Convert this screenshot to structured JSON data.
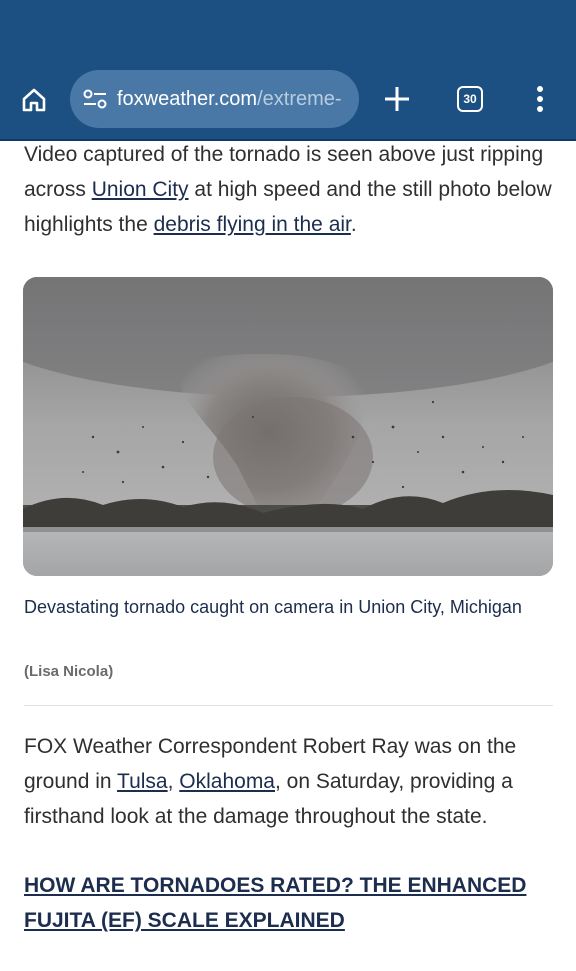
{
  "browser": {
    "url_domain": "foxweather.com",
    "url_path": "/extreme-",
    "tab_count": "30",
    "icons": [
      "home-icon",
      "site-settings-icon",
      "plus-icon",
      "tab-switcher-icon",
      "more-vert-icon"
    ]
  },
  "article": {
    "para1": {
      "text_a": "Video captured of the tornado is seen above just ripping across ",
      "link1": "Union City",
      "text_b": " at high speed and the still photo below highlights the ",
      "link2": "debris flying in the air",
      "text_c": "."
    },
    "photo": {
      "caption": "Devastating tornado caught on camera in Union City, Michigan",
      "credit": "(Lisa Nicola)"
    },
    "para2": {
      "text_a": "FOX Weather Correspondent Robert Ray was on the ground in ",
      "link1": "Tulsa",
      "text_b": ", ",
      "link2": "Oklahoma",
      "text_c": ", on Saturday, providing a firsthand look at the damage throughout the state."
    },
    "related_link": "HOW ARE TORNADOES RATED? THE ENHANCED FUJITA (EF) SCALE EXPLAINED"
  },
  "colors": {
    "toolbar": "#1d5082",
    "urlbar": "#4a78a6",
    "link": "#1c2d4e",
    "body_text": "#2f2f2f"
  }
}
